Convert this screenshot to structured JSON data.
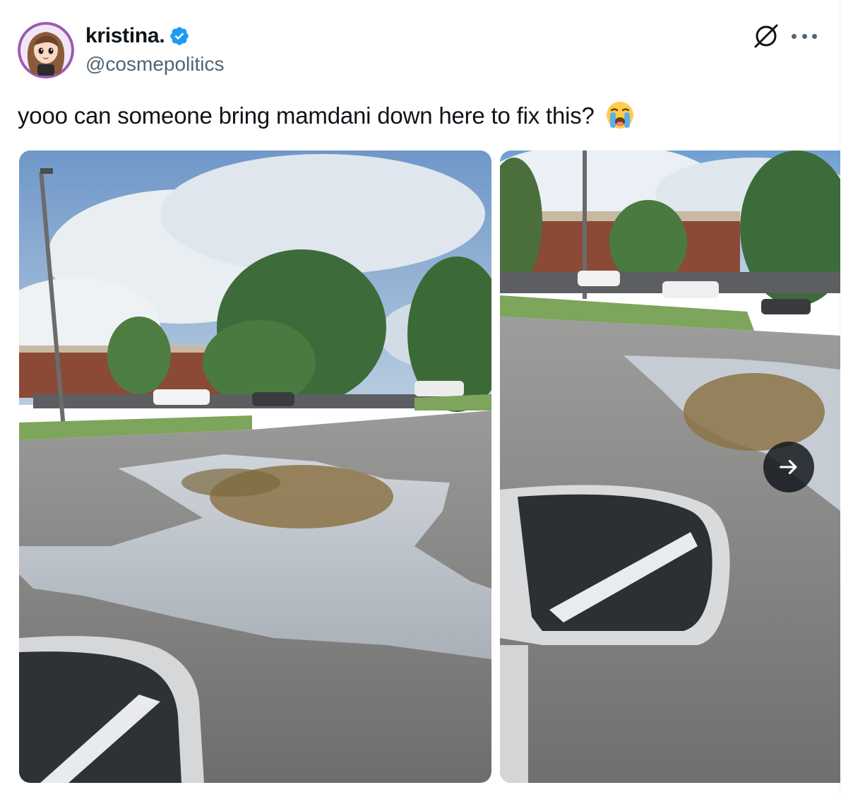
{
  "author": {
    "display_name": "kristina.",
    "handle": "@cosmepolitics",
    "verified": true,
    "avatar_icon": "cartoon-avatar-icon"
  },
  "header_actions": {
    "grok_icon": "grok-icon",
    "more_icon": "more-options-icon"
  },
  "tweet": {
    "text": "yooo can someone bring mamdani down here to fix this?",
    "emoji": "loudly-crying-face-emoji"
  },
  "media": {
    "items": [
      {
        "description_icon": "photo-parking-lot-puddle"
      },
      {
        "description_icon": "photo-parking-lot-puddle-mirror"
      }
    ],
    "next_icon": "arrow-right-icon"
  },
  "colors": {
    "verified_blue": "#1d9bf0",
    "handle_gray": "#536471",
    "text": "#0f1419"
  }
}
